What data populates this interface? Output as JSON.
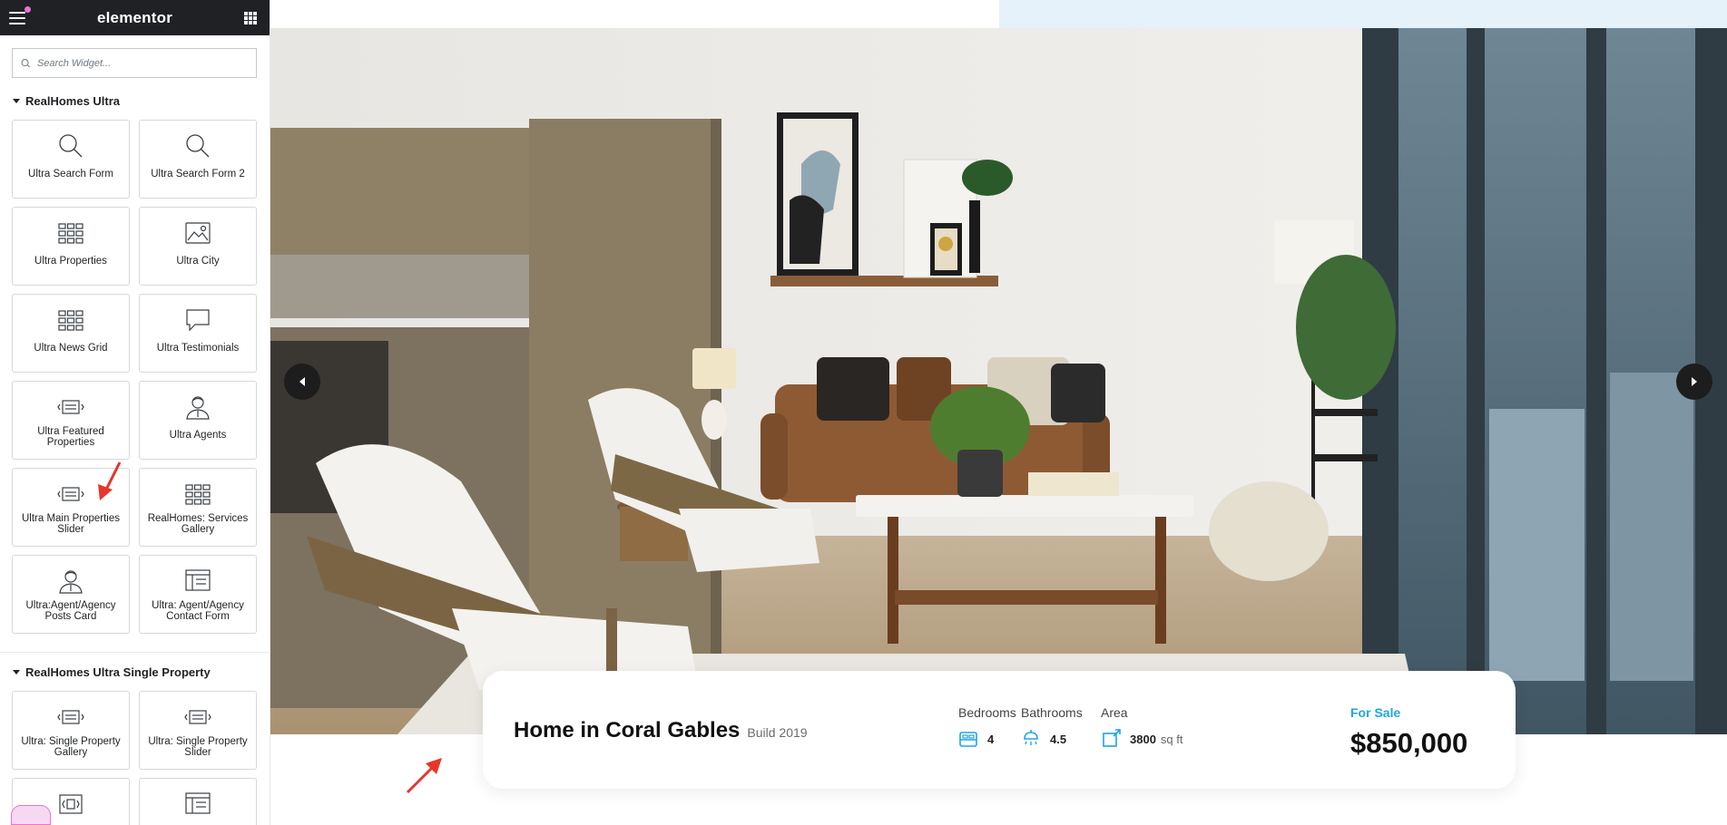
{
  "app": {
    "logo": "elementor"
  },
  "search": {
    "placeholder": "Search Widget..."
  },
  "categories": [
    {
      "title": "RealHomes Ultra",
      "widgets": [
        {
          "label": "Ultra Search Form",
          "icon": "search-icon"
        },
        {
          "label": "Ultra Search Form 2",
          "icon": "search-icon"
        },
        {
          "label": "Ultra Properties",
          "icon": "grid-icon"
        },
        {
          "label": "Ultra City",
          "icon": "image-icon"
        },
        {
          "label": "Ultra News Grid",
          "icon": "grid-icon"
        },
        {
          "label": "Ultra Testimonials",
          "icon": "speech-bubble-icon"
        },
        {
          "label": "Ultra Featured Properties",
          "icon": "slider-icon"
        },
        {
          "label": "Ultra Agents",
          "icon": "person-icon"
        },
        {
          "label": "Ultra Main Properties Slider",
          "icon": "slider-icon"
        },
        {
          "label": "RealHomes: Services Gallery",
          "icon": "grid-icon"
        },
        {
          "label": "Ultra:Agent/Agency Posts Card",
          "icon": "person-icon"
        },
        {
          "label": "Ultra: Agent/Agency Contact Form",
          "icon": "form-icon"
        }
      ]
    },
    {
      "title": "RealHomes Ultra Single Property",
      "widgets": [
        {
          "label": "Ultra: Single Property Gallery",
          "icon": "slider-icon"
        },
        {
          "label": "Ultra: Single Property Slider",
          "icon": "slider-icon"
        },
        {
          "label": "",
          "icon": "gallery-icon"
        },
        {
          "label": "",
          "icon": "form-icon"
        }
      ]
    }
  ],
  "property": {
    "title": "Home in Coral Gables",
    "build": "Build 2019",
    "bedrooms_label": "Bedrooms",
    "bedrooms": "4",
    "bathrooms_label": "Bathrooms",
    "bathrooms": "4.5",
    "area_label": "Area",
    "area": "3800",
    "area_unit": "sq ft",
    "status": "For Sale",
    "price": "$850,000"
  },
  "colors": {
    "accent": "#1ea4e9",
    "topbar": "#1f2124",
    "annotation_arrow": "#e8352a"
  }
}
